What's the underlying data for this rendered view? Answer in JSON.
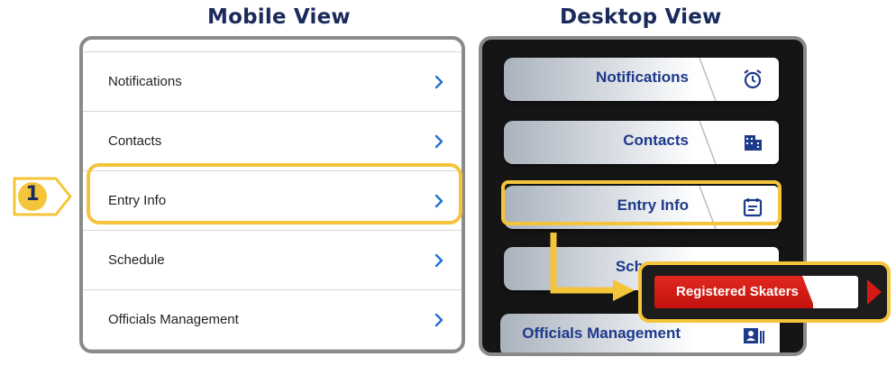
{
  "headings": {
    "mobile": "Mobile View",
    "desktop": "Desktop View"
  },
  "step": {
    "number": "1"
  },
  "mobile": {
    "items": [
      {
        "label": "Notifications"
      },
      {
        "label": "Contacts"
      },
      {
        "label": "Entry Info"
      },
      {
        "label": "Schedule"
      },
      {
        "label": "Officials Management"
      }
    ]
  },
  "desktop": {
    "items": [
      {
        "label": "Notifications",
        "icon": "alarm-clock-icon"
      },
      {
        "label": "Contacts",
        "icon": "building-icon"
      },
      {
        "label": "Entry Info",
        "icon": "calendar-icon"
      },
      {
        "label": "Sch",
        "icon": "calendar-icon"
      },
      {
        "label": "Officials Management",
        "icon": "id-card-icon"
      }
    ]
  },
  "popup": {
    "label": "Registered Skaters"
  },
  "colors": {
    "highlight": "#f4c43a",
    "heading": "#1a2a5c",
    "desktop_label": "#1e3a8a",
    "mobile_chevron": "#1e73d2",
    "popup_red": "#d41a14"
  }
}
